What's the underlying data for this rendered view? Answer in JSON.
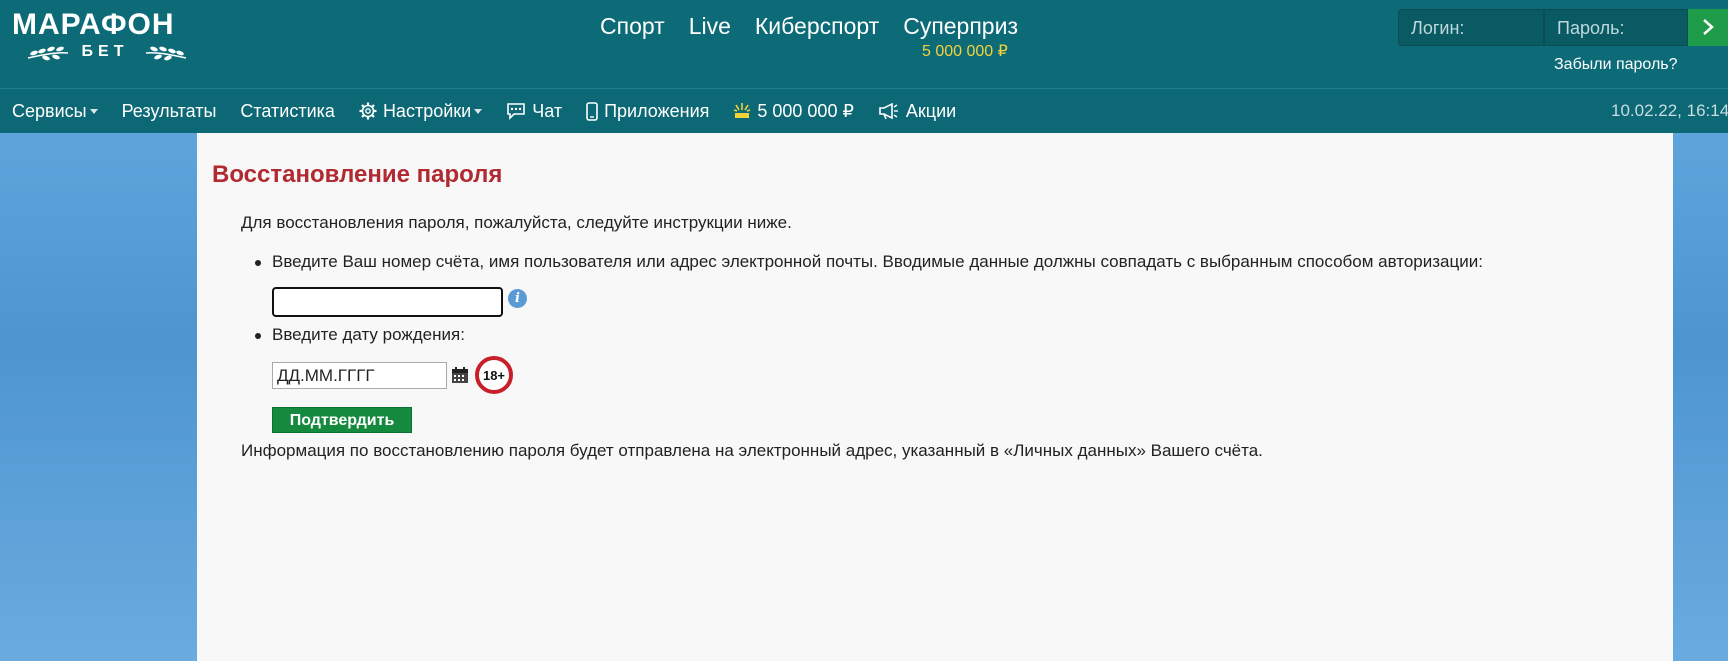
{
  "brand": {
    "logo_main": "МАРАФОН",
    "logo_sub": "БЕТ"
  },
  "main_nav": {
    "items": [
      "Спорт",
      "Live",
      "Киберспорт",
      "Суперприз"
    ],
    "jackpot_amount": "5 000 000 ₽"
  },
  "login": {
    "login_placeholder": "Логин:",
    "password_placeholder": "Пароль:",
    "submit_icon": "chevron-right-icon",
    "forgot_label": "Забыли пароль?"
  },
  "secondary_nav": {
    "services": "Сервисы",
    "results": "Результаты",
    "statistics": "Статистика",
    "settings": "Настройки",
    "chat": "Чат",
    "apps": "Приложения",
    "jackpot": "5 000 000 ₽",
    "promos": "Акции",
    "datetime": "10.02.22, 16:14"
  },
  "page": {
    "title": "Восстановление пароля",
    "intro": "Для восстановления пароля, пожалуйста, следуйте инструкции ниже.",
    "step1": "Введите Ваш номер счёта, имя пользователя или адрес электронной почты. Вводимые данные должны совпадать с выбранным способом авторизации:",
    "account_value": "",
    "step2": "Введите дату рождения:",
    "dob_value": "ДД.ММ.ГГГГ",
    "age_badge": "18+",
    "confirm_label": "Подтвердить",
    "note": "Информация по восстановлению пароля будет отправлена на электронный адрес, указанный в «Личных данных» Вашего счёта."
  },
  "colors": {
    "header_bg": "#0d6b78",
    "title_red": "#b12931",
    "accent_green": "#158a3f",
    "jackpot_yellow": "#f3d23a"
  }
}
